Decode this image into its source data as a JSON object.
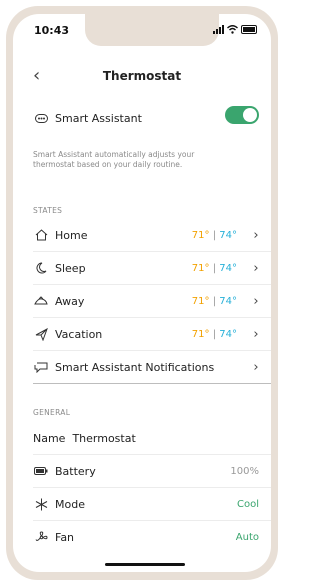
{
  "status_bar": {
    "time": "10:43"
  },
  "header": {
    "title": "Thermostat"
  },
  "smart_assistant": {
    "label": "Smart Assistant",
    "enabled": true,
    "description": "Smart Assistant automatically adjusts your thermostat based on your daily routine."
  },
  "states": {
    "section_label": "STATES",
    "items": [
      {
        "label": "Home",
        "heat": "71°",
        "separator": "|",
        "cool": "74°"
      },
      {
        "label": "Sleep",
        "heat": "71°",
        "separator": "|",
        "cool": "74°"
      },
      {
        "label": "Away",
        "heat": "71°",
        "separator": "|",
        "cool": "74°"
      },
      {
        "label": "Vacation",
        "heat": "71°",
        "separator": "|",
        "cool": "74°"
      }
    ],
    "notifications_label": "Smart Assistant Notifications"
  },
  "general": {
    "section_label": "GENERAL",
    "name_label": "Name",
    "name_value": "Thermostat",
    "battery_label": "Battery",
    "battery_value": "100%",
    "mode_label": "Mode",
    "mode_value": "Cool",
    "fan_label": "Fan",
    "fan_value": "Auto"
  },
  "colors": {
    "accent_green": "#3aa56e",
    "heat": "#f2a100",
    "cool": "#27b0d8",
    "frame": "#e8dfd6"
  }
}
